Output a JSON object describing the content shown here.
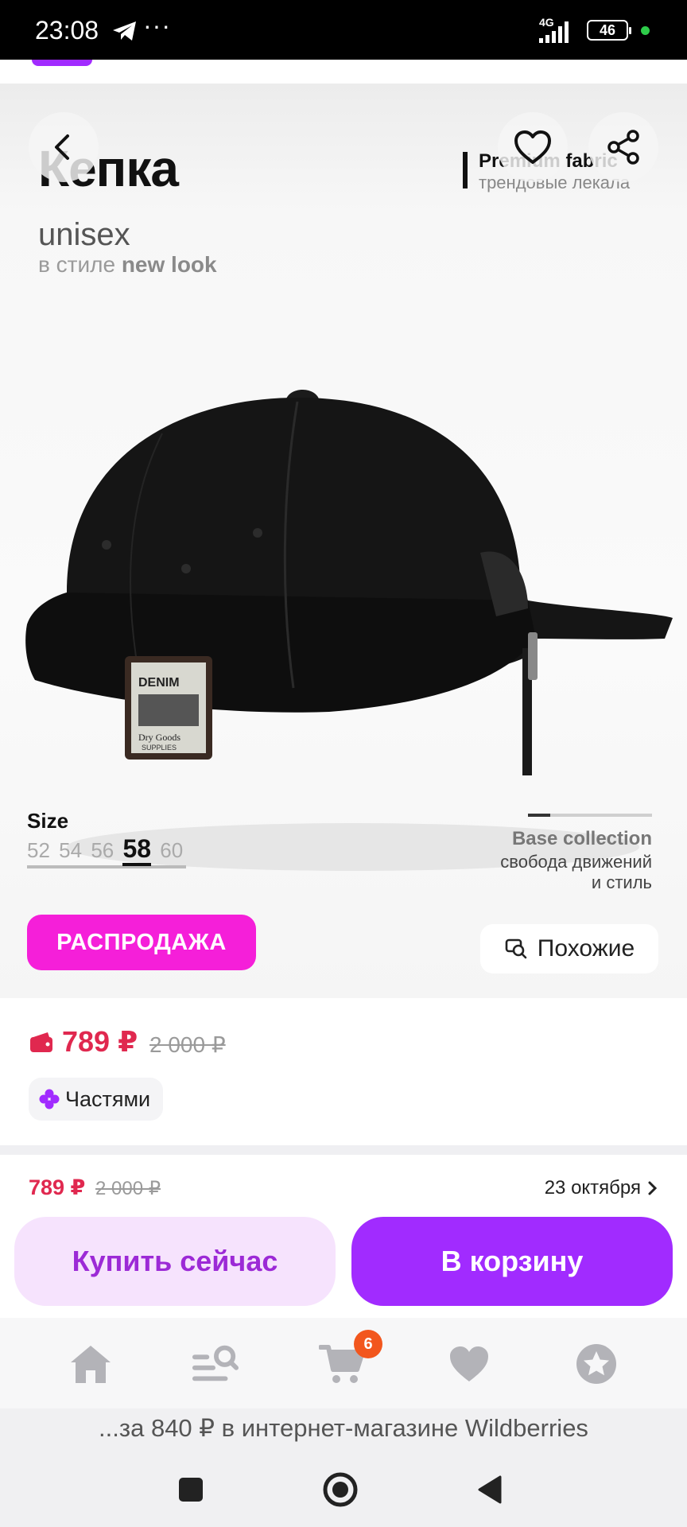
{
  "status_bar": {
    "time": "23:08",
    "extra": "···",
    "network": "4G",
    "battery": "46",
    "icons": [
      "telegram-icon",
      "signal-icon",
      "battery-icon"
    ]
  },
  "banner": {
    "title": "Кепка",
    "subtitle": "unisex",
    "style_prefix": "в стиле",
    "style_bold": "new look",
    "premium": "Premium fabric",
    "premium_sub": "трендовые лекала"
  },
  "sizes": {
    "title": "Size",
    "options": [
      "52",
      "54",
      "56",
      "58",
      "60"
    ],
    "selected": "58"
  },
  "collection": {
    "title": "Base collection",
    "line1": "свобода движений",
    "line2": "и стиль"
  },
  "hero_actions": {
    "sale": "РАСПРОДАЖА",
    "similar": "Похожие"
  },
  "price": {
    "current": "789 ₽",
    "old": "2 000 ₽",
    "installments": "Частями"
  },
  "buy_panel": {
    "price": "789 ₽",
    "old": "2 000 ₽",
    "delivery_date": "23 октября",
    "buy_now": "Купить сейчас",
    "add_to_cart": "В корзину"
  },
  "bottom_nav": {
    "items": [
      "home-icon",
      "catalog-search-icon",
      "cart-icon",
      "favorites-icon",
      "profile-icon"
    ],
    "cart_badge": "6"
  },
  "ad_line": "...за 840 ₽ в интернет-магазине Wildberries",
  "colors": {
    "accent": "#a12bff",
    "sale": "#f51fd9",
    "price": "#e0284f",
    "badge": "#f2561d"
  }
}
